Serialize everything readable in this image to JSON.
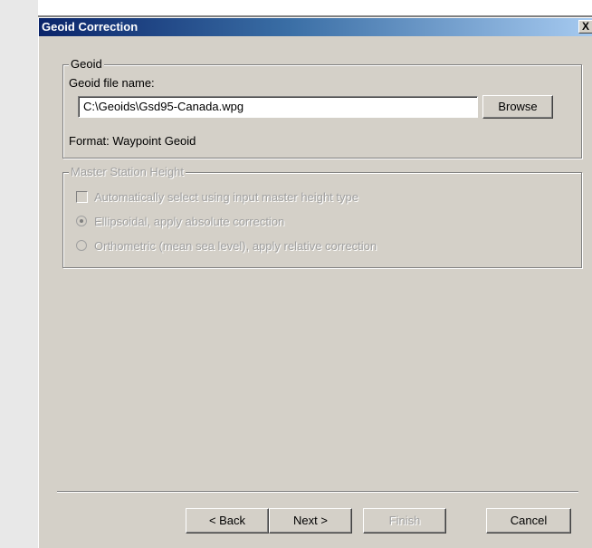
{
  "window": {
    "title": "Geoid Correction",
    "close_label": "X"
  },
  "geoid_group": {
    "legend": "Geoid",
    "file_label": "Geoid file name:",
    "file_value": "C:\\Geoids\\Gsd95-Canada.wpg",
    "browse_label": "Browse",
    "format_text": "Format: Waypoint Geoid"
  },
  "master_group": {
    "legend": "Master Station Height",
    "auto_select_label": "Automatically select using input master height type",
    "ellipsoidal_label": "Ellipsoidal, apply absolute correction",
    "orthometric_label": "Orthometric (mean sea level), apply relative correction"
  },
  "footer": {
    "back_label": "< Back",
    "next_label": "Next >",
    "finish_label": "Finish",
    "cancel_label": "Cancel"
  }
}
